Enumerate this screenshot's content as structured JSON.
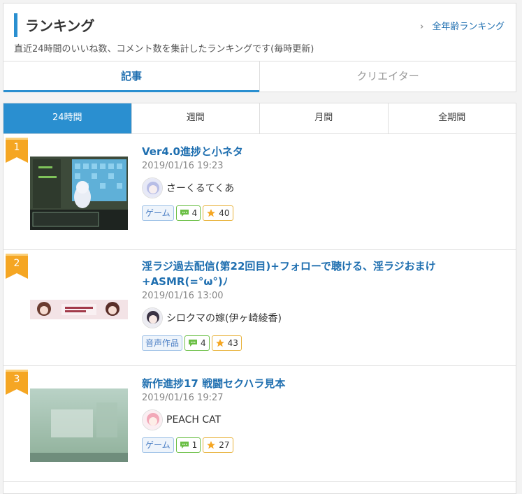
{
  "header": {
    "title": "ランキング",
    "description": "直近24時間のいいね数、コメント数を集計したランキングです(毎時更新)",
    "all_age_link": "全年齢ランキング",
    "tabs": [
      "記事",
      "クリエイター"
    ]
  },
  "period_tabs": [
    "24時間",
    "週間",
    "月間",
    "全期間"
  ],
  "items": [
    {
      "rank": "1",
      "title": "Ver4.0進捗と小ネタ",
      "date": "2019/01/16 19:23",
      "author": "さーくるてくあ",
      "category": "ゲーム",
      "comments": "4",
      "stars": "40"
    },
    {
      "rank": "2",
      "title": "淫ラジ過去配信(第22回目)+フォローで聴ける、淫ラジおまけ+ASMR(=°ω°)ﾉ",
      "date": "2019/01/16 13:00",
      "author": "シロクマの嫁(伊ヶ崎綾香)",
      "category": "音声作品",
      "comments": "4",
      "stars": "43"
    },
    {
      "rank": "3",
      "title": "新作進捗17 戦闘セクハラ見本",
      "date": "2019/01/16 19:27",
      "author": "PEACH CAT",
      "category": "ゲーム",
      "comments": "1",
      "stars": "27"
    }
  ],
  "colors": {
    "accent": "#2a8fd0",
    "link": "#1f6fb0",
    "rank_ribbon": "#f5a623"
  }
}
